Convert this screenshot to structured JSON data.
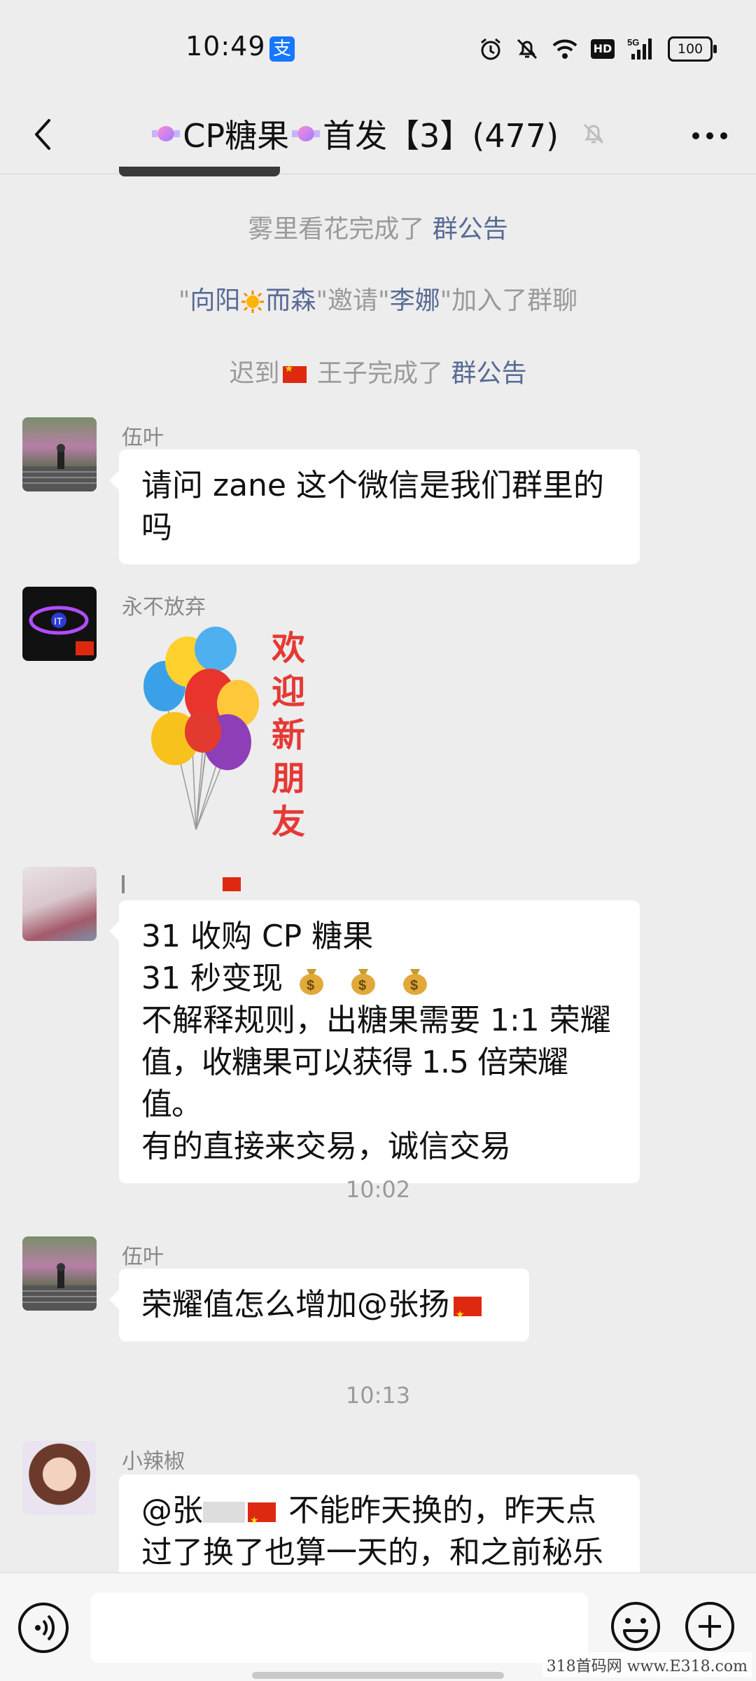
{
  "status_bar": {
    "time": "10:49",
    "alipay_glyph": "支",
    "battery": "100",
    "network": "5G",
    "hd": "HD"
  },
  "nav": {
    "title_prefix": "CP糖果",
    "title_mid": "首发【3】(477)"
  },
  "system_messages": [
    {
      "before": "雾里看花完成了 ",
      "link": "群公告"
    },
    {
      "q1": "\"",
      "inviter_a": "向阳",
      "inviter_b": "而森",
      "mid": "\"邀请\"",
      "invitee": "李娜",
      "after": "\"加入了群聊"
    },
    {
      "before": "迟到",
      "after": " 王子完成了 ",
      "link": "群公告"
    }
  ],
  "messages": [
    {
      "sender": "伍叶",
      "text": "请问 zane 这个微信是我们群里的\n吗"
    },
    {
      "sender": "永不放弃",
      "sticker_text": "欢迎新朋友"
    },
    {
      "sender": "",
      "lines": [
        "31 收购 CP 糖果",
        "31 秒变现",
        "不解释规则，出糖果需要 1:1 荣耀",
        "值，收糖果可以获得 1.5 倍荣耀值。",
        "有的直接来交易，诚信交易"
      ]
    },
    {
      "sender": "伍叶",
      "text": "荣耀值怎么增加@张扬"
    },
    {
      "sender": "小辣椒",
      "line1_a": "@张",
      "line1_b": " 不能昨天换的，昨天点",
      "line2": "过了换了也算一天的，和之前秘乐"
    }
  ],
  "timestamps": [
    "10:02",
    "10:13"
  ],
  "watermark": "318首码网  www.E318.com",
  "colors": {
    "background": "#ededed",
    "bubble": "#ffffff",
    "link": "#576b95",
    "system_text": "#9a9a9a"
  }
}
